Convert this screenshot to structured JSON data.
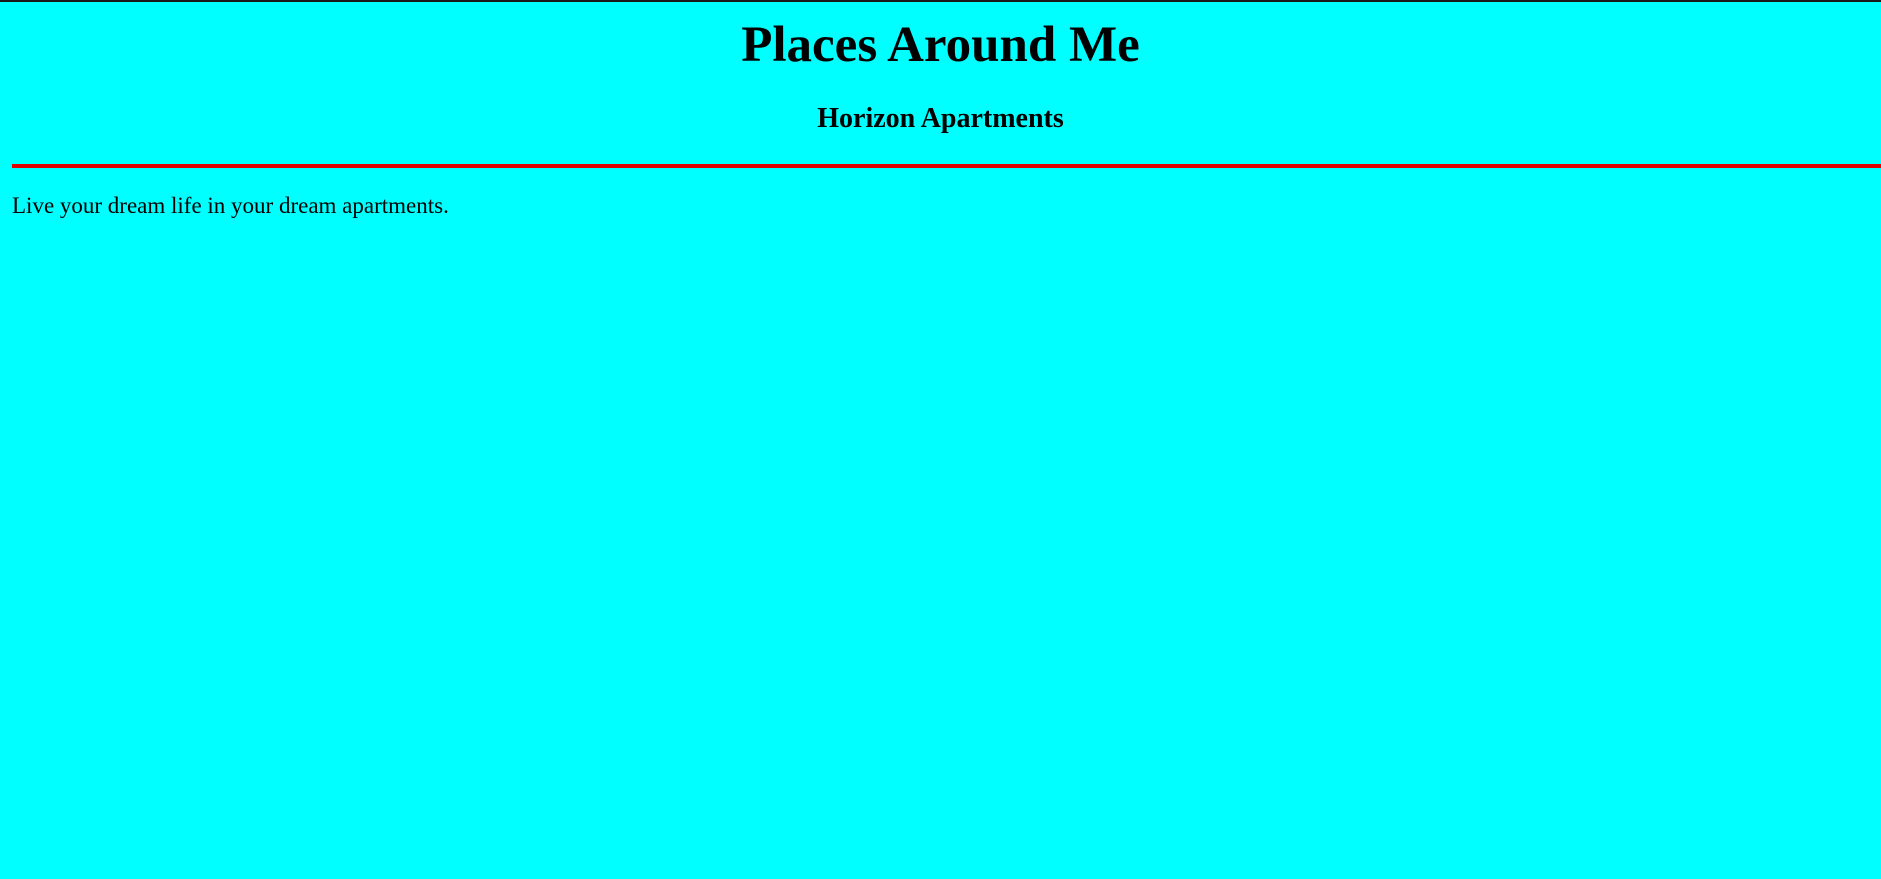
{
  "header": {
    "title": "Places Around Me",
    "subtitle": "Horizon Apartments"
  },
  "main": {
    "tagline": "Live your dream life in your dream apartments."
  },
  "colors": {
    "background": "#00ffff",
    "divider": "#e10000",
    "text": "#000000"
  }
}
